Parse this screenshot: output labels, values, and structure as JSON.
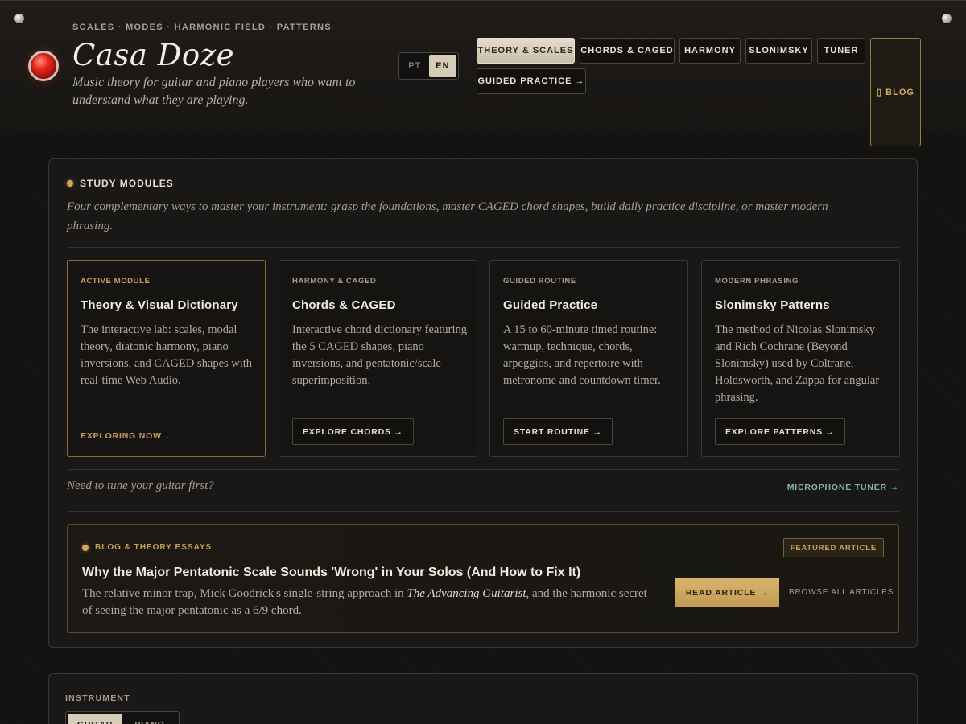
{
  "header": {
    "eyebrow": "SCALES · MODES · HARMONIC FIELD · PATTERNS",
    "brand": "Casa Doze",
    "tagline": "Music theory for guitar and piano players who want to understand what they are playing.",
    "lang": {
      "pt": "PT",
      "en": "EN",
      "selected": "EN"
    },
    "nav": {
      "theory": "THEORY & SCALES",
      "chords": "CHORDS & CAGED",
      "harmony": "HARMONY",
      "slonimsky": "SLONIMSKY",
      "tuner": "TUNER",
      "blog": "▯ BLOG",
      "practice": "GUIDED PRACTICE →"
    }
  },
  "modules": {
    "title": "STUDY MODULES",
    "description": "Four complementary ways to master your instrument: grasp the foundations, master CAGED chord shapes, build daily practice discipline, or master modern phrasing.",
    "cards": [
      {
        "kicker": "ACTIVE MODULE",
        "title": "Theory & Visual Dictionary",
        "desc": "The interactive lab: scales, modal theory, diatonic harmony, piano inversions, and CAGED shapes with real-time Web Audio.",
        "cta": "EXPLORING NOW ↓"
      },
      {
        "kicker": "HARMONY & CAGED",
        "title": "Chords & CAGED",
        "desc": "Interactive chord dictionary featuring the 5 CAGED shapes, piano inversions, and pentatonic/scale superimposition.",
        "cta": "EXPLORE CHORDS →"
      },
      {
        "kicker": "GUIDED ROUTINE",
        "title": "Guided Practice",
        "desc": "A 15 to 60-minute timed routine: warmup, technique, chords, arpeggios, and repertoire with metronome and countdown timer.",
        "cta": "START ROUTINE →"
      },
      {
        "kicker": "MODERN PHRASING",
        "title": "Slonimsky Patterns",
        "desc": "The method of Nicolas Slonimsky and Rich Cochrane (Beyond Slonimsky) used by Coltrane, Holdsworth, and Zappa for angular phrasing.",
        "cta": "EXPLORE PATTERNS →"
      }
    ],
    "tune_question": "Need to tune your guitar first?",
    "tune_link": "MICROPHONE TUNER →"
  },
  "blog": {
    "kicker": "BLOG & THEORY ESSAYS",
    "badge": "FEATURED ARTICLE",
    "title": "Why the Major Pentatonic Scale Sounds 'Wrong' in Your Solos (And How to Fix It)",
    "desc_before": "The relative minor trap, Mick Goodrick's single-string approach in ",
    "desc_book": "The Advancing Guitarist",
    "desc_after": ", and the harmonic secret of seeing the major pentatonic as a 6/9 chord.",
    "read": "READ ARTICLE →",
    "browse": "BROWSE ALL ARTICLES"
  },
  "instrument": {
    "label": "INSTRUMENT",
    "options": [
      "GUITAR",
      "PIANO"
    ],
    "selected": "GUITAR"
  },
  "colors": {
    "accent": "#d4a653",
    "led": "#e5261b",
    "teal_link": "#7fb8a8"
  }
}
